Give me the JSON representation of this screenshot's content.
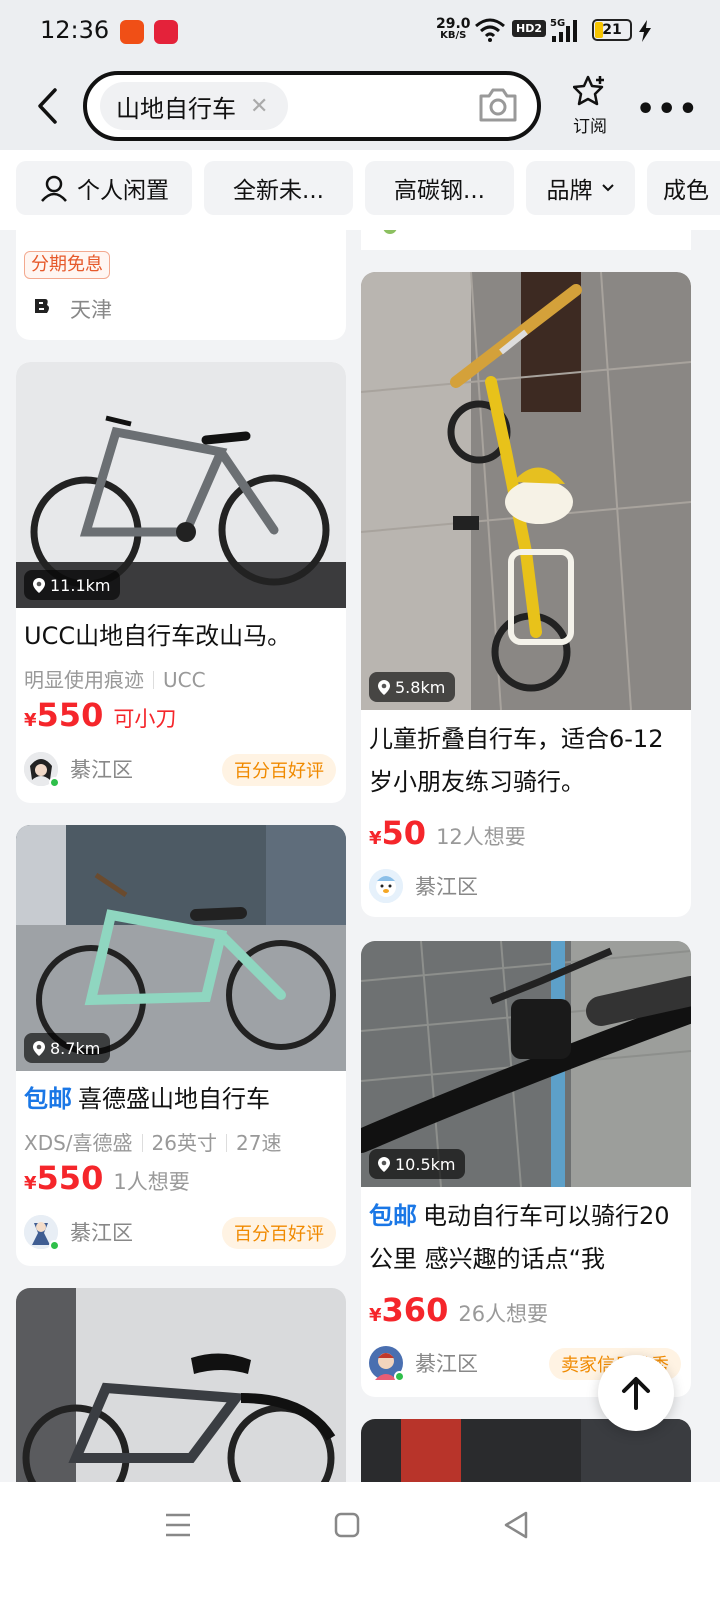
{
  "status": {
    "time": "12:36",
    "net_speed": "29.0",
    "net_unit": "KB/S",
    "hd": "HD2",
    "signal": "5G",
    "battery": "21"
  },
  "search": {
    "query": "山地自行车",
    "subscribe_label": "订阅"
  },
  "filters": [
    "个人闲置",
    "全新未...",
    "高碳钢...",
    "品牌",
    "成色"
  ],
  "colors": {
    "price_red": "#f5262b",
    "free_ship_blue": "#1a77e6",
    "tag_orange": "#f08a00"
  },
  "cards": {
    "top_left": {
      "tag": "分期免息",
      "location": "天津"
    },
    "ucc": {
      "distance": "11.1km",
      "title": "UCC山地自行车改山马。",
      "attrs": [
        "明显使用痕迹",
        "UCC"
      ],
      "price_yen": "¥",
      "price": "550",
      "price_note": "可小刀",
      "location": "綦江区",
      "badge": "百分百好评"
    },
    "mint": {
      "distance": "8.7km",
      "free_ship": "包邮",
      "title": "喜德盛山地自行车",
      "attrs": [
        "XDS/喜德盛",
        "26英寸",
        "27速"
      ],
      "price_yen": "¥",
      "price": "550",
      "price_note": "1人想要",
      "location": "綦江区",
      "badge": "百分百好评"
    },
    "kids": {
      "distance": "5.8km",
      "title": "儿童折叠自行车，适合6-12岁小朋友练习骑行。",
      "price_yen": "¥",
      "price": "50",
      "price_note": "12人想要",
      "location": "綦江区"
    },
    "ebike": {
      "distance": "10.5km",
      "free_ship": "包邮",
      "title": "电动自行车可以骑行20公里 感兴趣的话点“我",
      "price_yen": "¥",
      "price": "360",
      "price_note": "26人想要",
      "location": "綦江区",
      "badge": "卖家信用优秀"
    }
  }
}
